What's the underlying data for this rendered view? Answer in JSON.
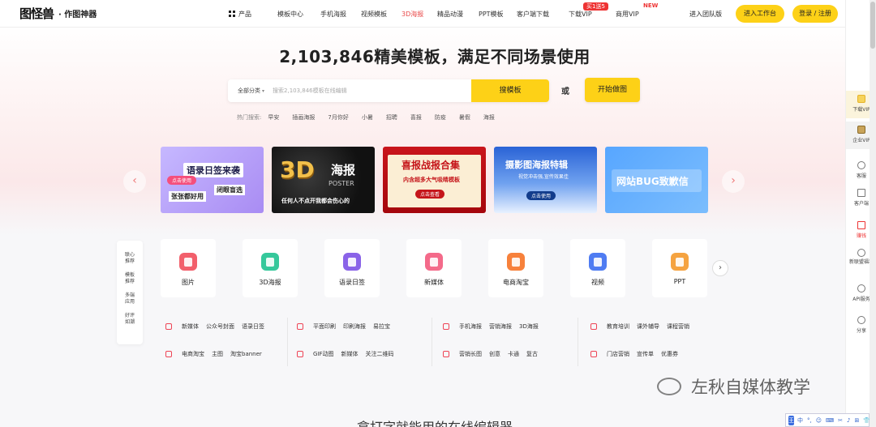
{
  "header": {
    "logo_mark": "图怪兽",
    "logo_sub": "· 作图神器",
    "nav": [
      {
        "label": "产品",
        "icon": "grid-icon"
      },
      {
        "label": "模板中心"
      },
      {
        "label": "手机海报"
      },
      {
        "label": "视频模板"
      },
      {
        "label": "3D海报",
        "active": true
      },
      {
        "label": "精品动漫"
      },
      {
        "label": "PPT模板"
      },
      {
        "label": "客户端下载"
      },
      {
        "label": "下载VIP",
        "badge": "买1送5"
      },
      {
        "label": "商用VIP",
        "badge": "NEW"
      }
    ],
    "join_team": "进入团队版",
    "workspace_btn": "进入工作台",
    "login_btn": "登录 / 注册"
  },
  "hero": {
    "headline": "2,103,846精美模板，满足不同场景使用",
    "search_category": "全部分类",
    "search_placeholder": "搜索2,103,846模板在线编辑",
    "search_btn": "搜模板",
    "or": "或",
    "start_btn": "开始做图",
    "hot_label": "热门搜索:",
    "hot_terms": [
      "早安",
      "插画海报",
      "7月你好",
      "小暑",
      "招聘",
      "喜报",
      "防疫",
      "暑假",
      "海报"
    ]
  },
  "banners": [
    {
      "title": "语录日签来袭",
      "line2": "张张都好用",
      "line3": "闭眼盲选",
      "pill": "点击使用"
    },
    {
      "title": "3D",
      "title2": "海报",
      "sub": "POSTER",
      "line2": "任何人不点开我都会伤心的"
    },
    {
      "title": "喜报战报合集",
      "line2": "内含超多大气吸睛模板",
      "pill": "点击查看"
    },
    {
      "title": "摄影图海报特辑",
      "line2": "视觉冲击强,宣传效果佳",
      "pill": "点击使用"
    },
    {
      "title": "网站BUG致歉信"
    }
  ],
  "side_tabs": [
    "联心推荐",
    "模板推荐",
    "多端应用",
    "好评如潮"
  ],
  "categories": [
    {
      "label": "图片",
      "color": "#f25f6b"
    },
    {
      "label": "3D海报",
      "color": "#35c89b"
    },
    {
      "label": "语录日签",
      "color": "#8a63e8"
    },
    {
      "label": "新媒体",
      "color": "#f46a8a"
    },
    {
      "label": "电商淘宝",
      "color": "#f7813b"
    },
    {
      "label": "视频",
      "color": "#4f7cf2"
    },
    {
      "label": "PPT",
      "color": "#f5a340"
    }
  ],
  "sub_links": [
    [
      "新媒体",
      "公众号封面",
      "语录日签"
    ],
    [
      "平面印刷",
      "印刷海报",
      "易拉宝"
    ],
    [
      "手机海报",
      "营销海报",
      "3D海报"
    ],
    [
      "教育培训",
      "课外辅导",
      "课程营销"
    ],
    [
      "电商淘宝",
      "主图",
      "淘宝banner"
    ],
    [
      "GIF动图",
      "新媒体",
      "关注二维码"
    ],
    [
      "营销长图",
      "创意",
      "卡通",
      "复古"
    ],
    [
      "门店营销",
      "宣传单",
      "优惠券"
    ]
  ],
  "right_bar": [
    "下载VIP",
    "企业VIP",
    "客服",
    "客户端",
    "赚钱",
    "新联盟福利",
    "API服务",
    "分享"
  ],
  "watermark": "左秋自媒体教学",
  "bottom_title": "拿打字就能用的在线编辑器",
  "ime": {
    "key": "王",
    "items": [
      "中",
      "°,",
      "☺",
      "⌨",
      "✂",
      "♪",
      "⊞",
      "👕",
      "⋯"
    ]
  },
  "colors": {
    "accent_yellow": "#fdd117",
    "active_red": "#e94949"
  }
}
